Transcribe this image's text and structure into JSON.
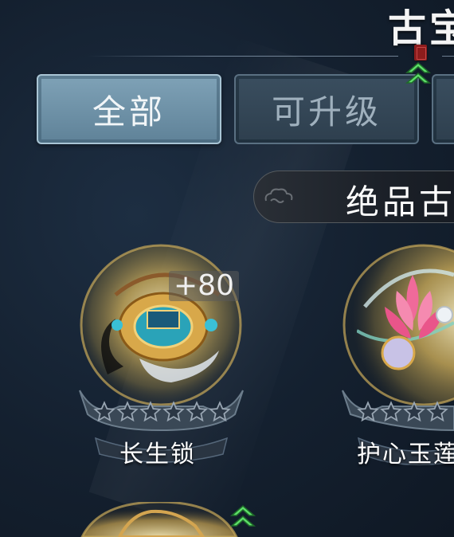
{
  "header": {
    "title": "古宝"
  },
  "tabs": [
    {
      "label": "全部",
      "active": true
    },
    {
      "label": "可升级",
      "active": false
    }
  ],
  "section": {
    "banner_label": "绝品古"
  },
  "items": [
    {
      "name": "长生锁",
      "level": "+80",
      "stars_filled": 0,
      "stars_total": 6,
      "upgradeable": false
    },
    {
      "name": "护心玉莲",
      "stars_filled": 0,
      "stars_total": 6,
      "upgradeable": false
    },
    {
      "name": "",
      "upgradeable": true
    }
  ],
  "colors": {
    "background": "#14202f",
    "tab_active": "#6f92a8",
    "tab_inactive": "#34475a",
    "upgrade_arrow": "#4ccf5a",
    "orb_glow": "#e8c66a",
    "seal_red": "#8c1c1c"
  },
  "icons": [
    "upgrade-arrow-icon",
    "cloud-icon",
    "star-icon",
    "seal-icon"
  ]
}
